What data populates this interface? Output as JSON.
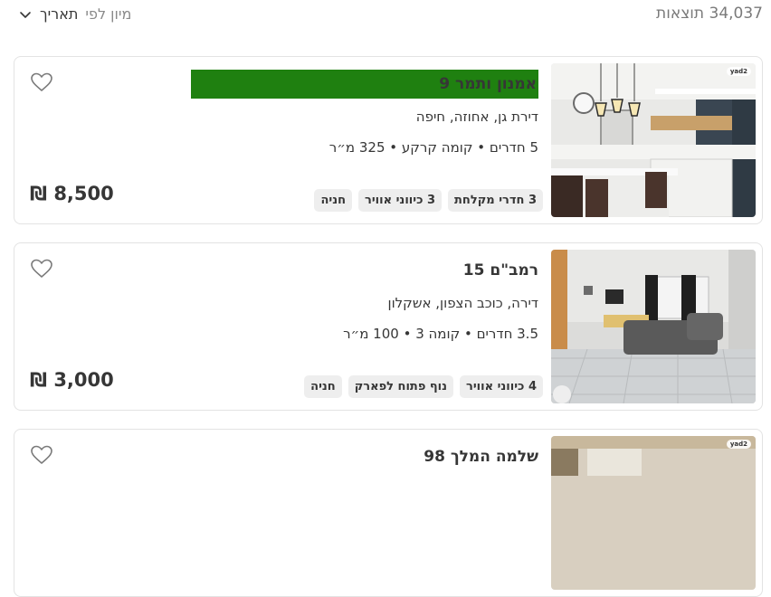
{
  "header": {
    "results_count": "34,037 תוצאות",
    "sort_label": "מיון לפי",
    "sort_value": "תאריך"
  },
  "listings": [
    {
      "title": "אמנון ותמר 9",
      "subtitle": "דירת גן, אחוזה, חיפה",
      "details": "5 חדרים • קומה קרקע • 325 מ״ר",
      "tags": [
        "3 חדרי מקלחת",
        "3 כיווני אוויר",
        "חניה"
      ],
      "price": "8,500 ₪",
      "photo_badge": "yad2",
      "title_highlight_color": "#1f8010"
    },
    {
      "title": "רמב\"ם 15",
      "subtitle": "דירה, כוכב הצפון, אשקלון",
      "details": "3.5 חדרים • קומה 3 • 100 מ״ר",
      "tags": [
        "4 כיווני אוויר",
        "נוף פתוח לפארק",
        "חניה"
      ],
      "price": "3,000 ₪",
      "photo_badge": ""
    },
    {
      "title": "שלמה המלך 98",
      "photo_badge": "yad2"
    }
  ],
  "icons": {
    "heart": "heart-outline-icon",
    "chevron": "chevron-down-icon"
  }
}
